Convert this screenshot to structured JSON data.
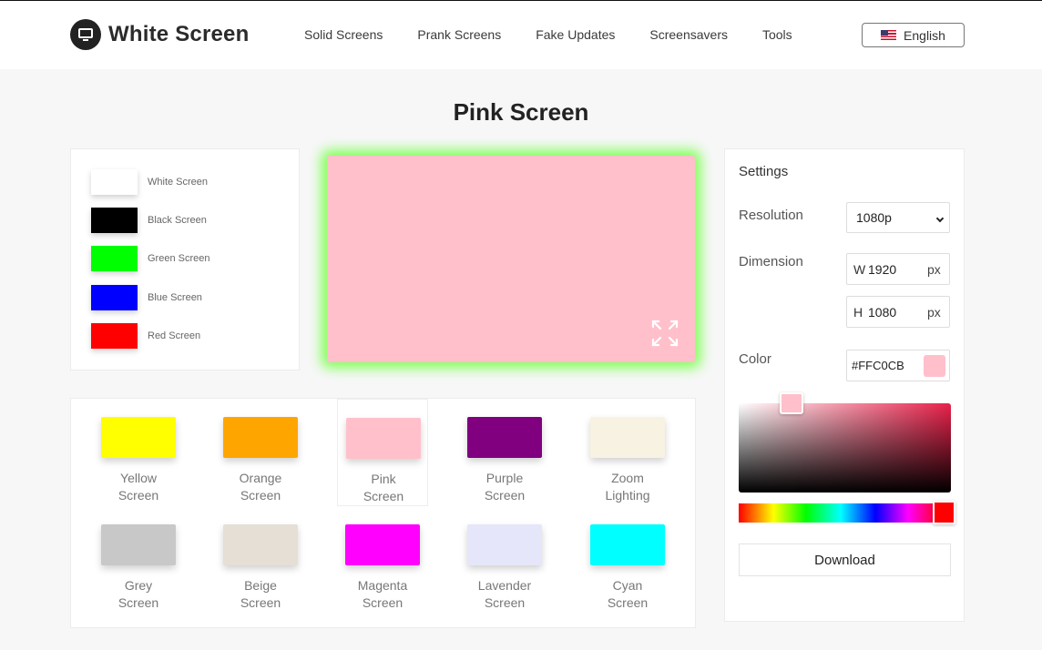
{
  "header": {
    "brand": "White Screen",
    "nav": [
      "Solid Screens",
      "Prank Screens",
      "Fake Updates",
      "Screensavers",
      "Tools"
    ],
    "language": "English"
  },
  "page_title": "Pink Screen",
  "quick_screens": [
    {
      "label": "White Screen",
      "color": "#ffffff"
    },
    {
      "label": "Black Screen",
      "color": "#000000"
    },
    {
      "label": "Green Screen",
      "color": "#00ff00"
    },
    {
      "label": "Blue Screen",
      "color": "#0000ff"
    },
    {
      "label": "Red Screen",
      "color": "#ff0000"
    }
  ],
  "preview": {
    "color": "#ffc0cb",
    "glow": "#7dff52",
    "icon": "fullscreen-icon"
  },
  "screen_grid": [
    {
      "line1": "Yellow",
      "line2": "Screen",
      "color": "#ffff00"
    },
    {
      "line1": "Orange",
      "line2": "Screen",
      "color": "#ffa500"
    },
    {
      "line1": "Pink",
      "line2": "Screen",
      "color": "#ffc0cb"
    },
    {
      "line1": "Purple",
      "line2": "Screen",
      "color": "#800080"
    },
    {
      "line1": "Zoom",
      "line2": "Lighting",
      "color": "#f7f2e1"
    },
    {
      "line1": "Grey",
      "line2": "Screen",
      "color": "#c8c8c8"
    },
    {
      "line1": "Beige",
      "line2": "Screen",
      "color": "#e6dfd6"
    },
    {
      "line1": "Magenta",
      "line2": "Screen",
      "color": "#ff00ff"
    },
    {
      "line1": "Lavender",
      "line2": "Screen",
      "color": "#e6e6fa"
    },
    {
      "line1": "Cyan",
      "line2": "Screen",
      "color": "#00ffff"
    }
  ],
  "settings": {
    "title": "Settings",
    "resolution_label": "Resolution",
    "resolution_value": "1080p",
    "dimension_label": "Dimension",
    "width_prefix": "W",
    "width_value": "1920",
    "height_prefix": "H",
    "height_value": "1080",
    "unit": "px",
    "color_label": "Color",
    "color_value": "#FFC0CB",
    "download_label": "Download"
  }
}
